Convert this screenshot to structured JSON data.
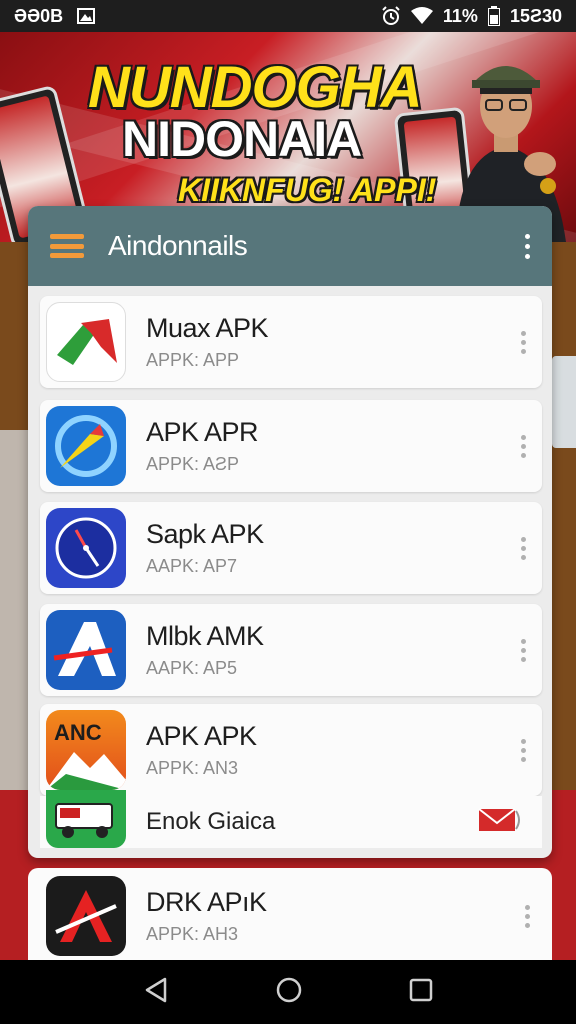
{
  "status_bar": {
    "time_left": "ƏƏ0Β",
    "battery_percent": "11%",
    "clock": "15Ƨ30"
  },
  "banner": {
    "title_line1": "NUNDOGHA",
    "title_line2": "NIDONAIA",
    "subtitle": "KIIKNFUG! APPI!"
  },
  "app_bar": {
    "title": "Aindonnails"
  },
  "apps": [
    {
      "name": "Muax APK",
      "subtitle": "APPK: APP",
      "icon": "red-green-arrow-icon"
    },
    {
      "name": "APK APR",
      "subtitle": "APPK: AƧP",
      "icon": "blue-compass-swoosh-icon"
    },
    {
      "name": "Sapk APK",
      "subtitle": "AAPK: AP7",
      "icon": "blue-clock-dial-icon"
    },
    {
      "name": "Mlbk AMK",
      "subtitle": "AAPK: AP5",
      "icon": "apk-letter-a-icon"
    },
    {
      "name": "APK APK",
      "subtitle": "APPK: AN3",
      "icon": "anc-mountain-icon"
    }
  ],
  "footer_row": {
    "text": "Enok Giaica",
    "icon": "mail-envelope-icon"
  },
  "bottom_app": {
    "name": "DRK APıK",
    "subtitle": "APPK: AH3",
    "icon": "black-red-a-icon"
  },
  "nav": {
    "back": "back-triangle-icon",
    "home": "home-circle-icon",
    "recents": "recents-square-icon"
  },
  "colors": {
    "app_bar": "#57767b",
    "menu_accent": "#f39a3a",
    "banner_red": "#c81e24",
    "banner_yellow": "#ffe11a"
  }
}
